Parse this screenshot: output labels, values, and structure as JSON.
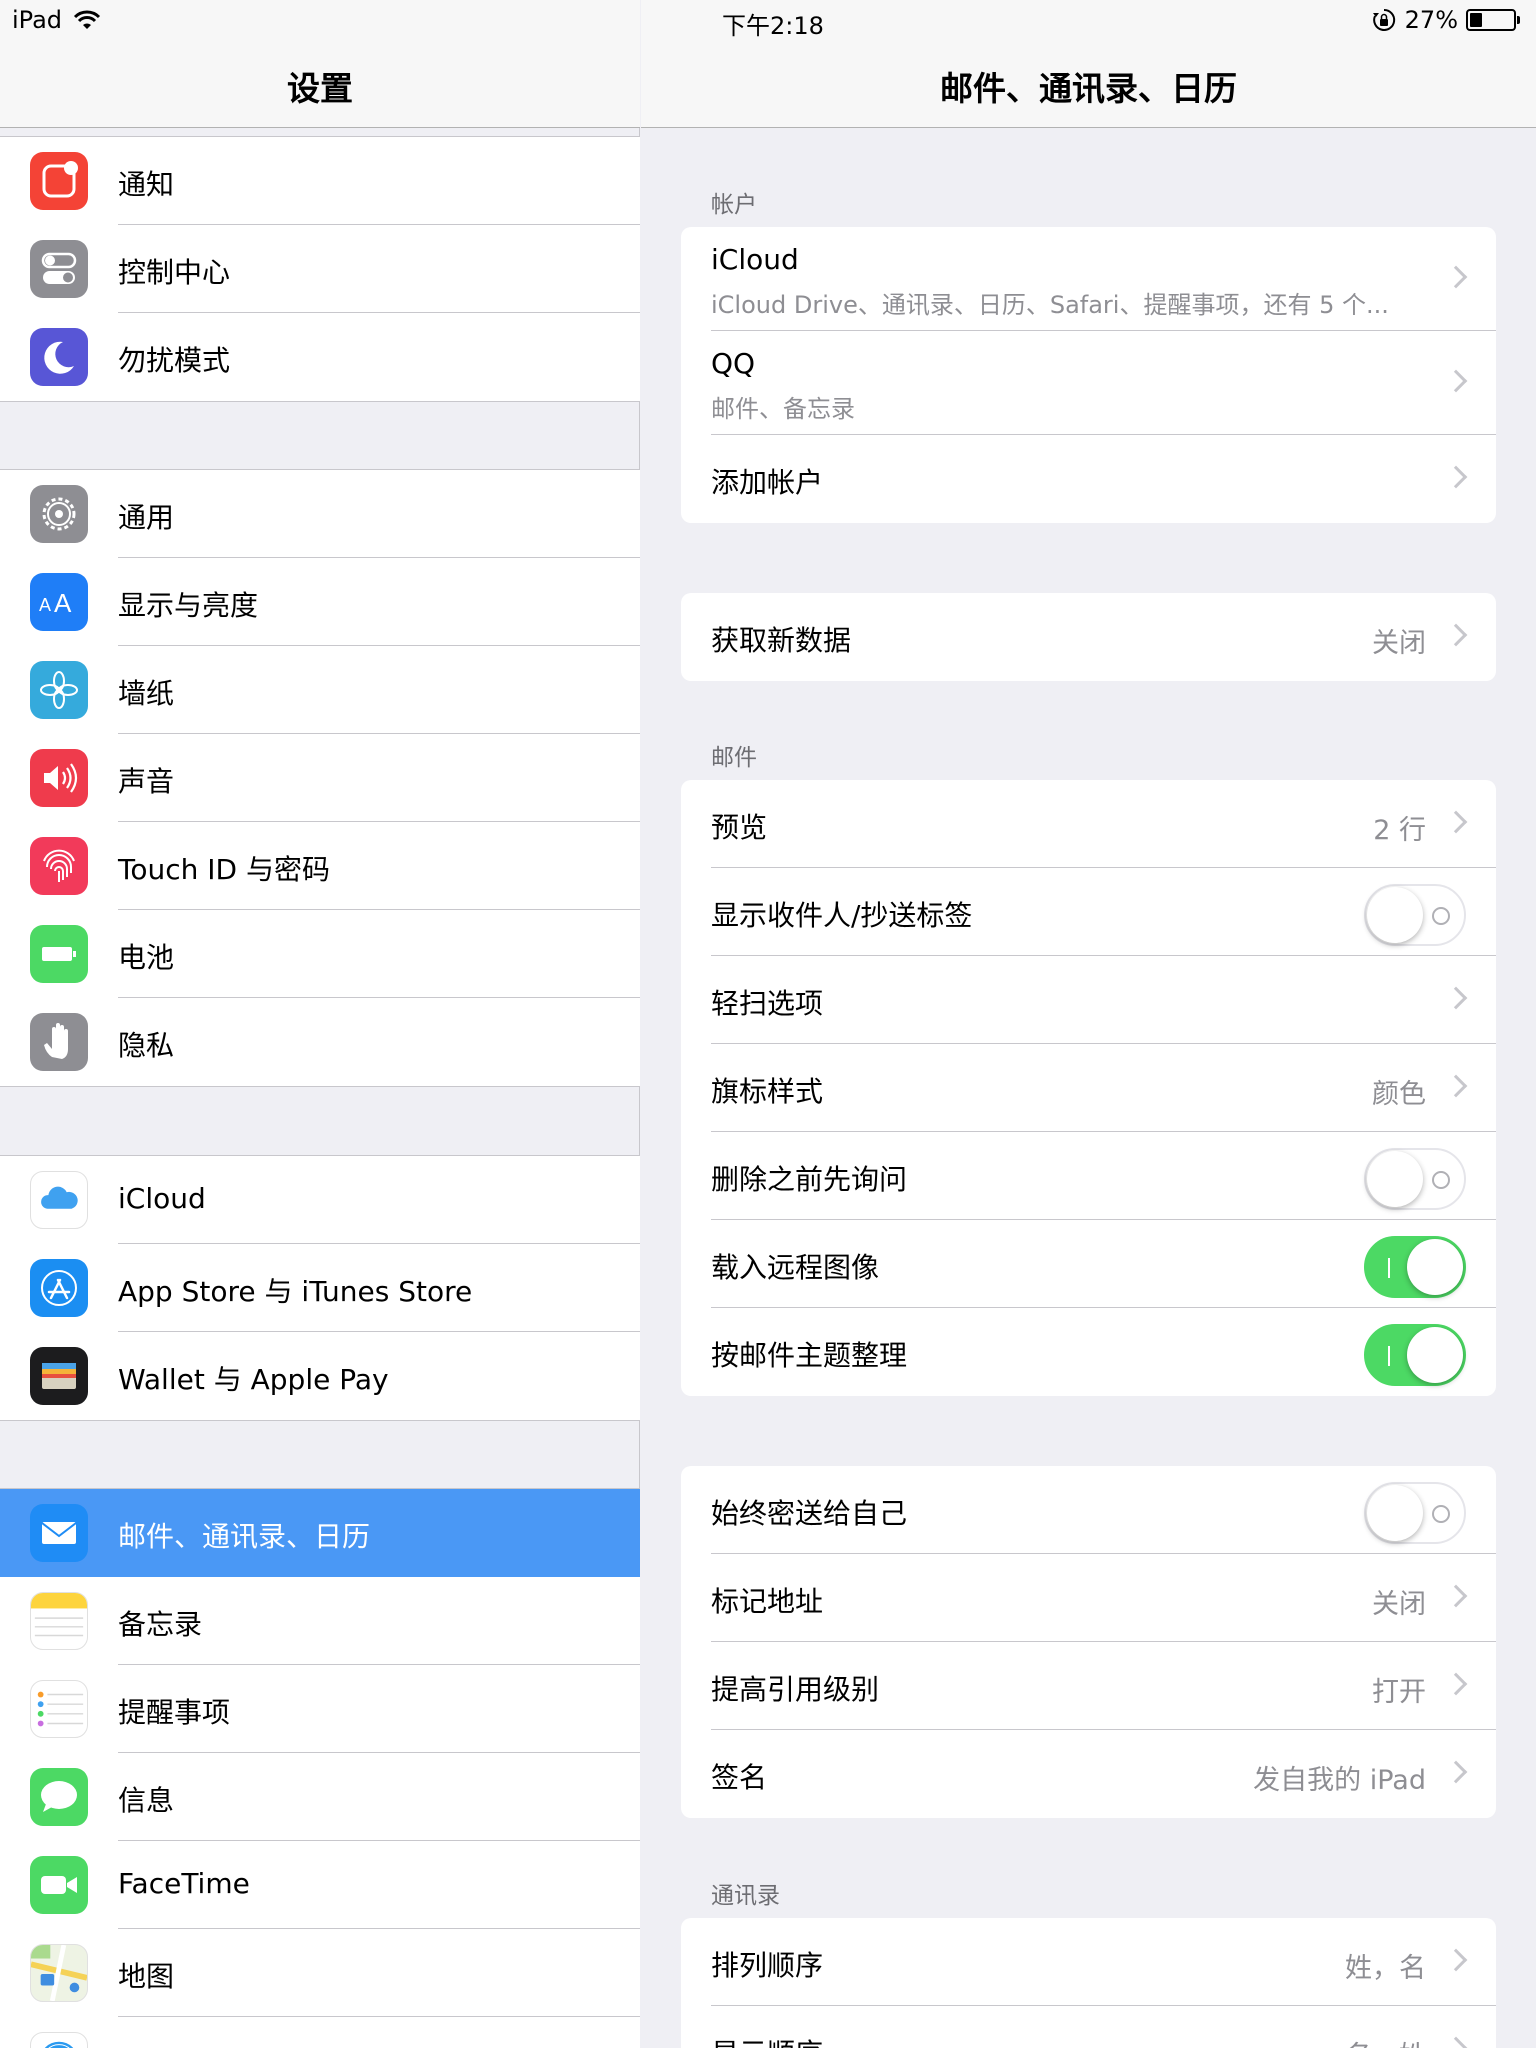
{
  "status_bar": {
    "device": "iPad",
    "time": "下午2:18",
    "battery": "27%"
  },
  "sidebar": {
    "title": "设置",
    "groups": [
      [
        {
          "label": "通知",
          "icon": "notifications-icon",
          "color": "#f44336"
        },
        {
          "label": "控制中心",
          "icon": "control-center-icon",
          "color": "#8e8e93"
        },
        {
          "label": "勿扰模式",
          "icon": "moon-icon",
          "color": "#5856d6"
        }
      ],
      [
        {
          "label": "通用",
          "icon": "gear-icon",
          "color": "#8e8e93"
        },
        {
          "label": "显示与亮度",
          "icon": "display-brightness-icon",
          "color": "#1f7ef7"
        },
        {
          "label": "墙纸",
          "icon": "wallpaper-icon",
          "color": "#35aadc"
        },
        {
          "label": "声音",
          "icon": "speaker-icon",
          "color": "#ef3b4c"
        },
        {
          "label": "Touch ID 与密码",
          "icon": "fingerprint-icon",
          "color": "#f23a5a"
        },
        {
          "label": "电池",
          "icon": "battery-icon",
          "color": "#4cd964"
        },
        {
          "label": "隐私",
          "icon": "hand-icon",
          "color": "#8e8e93"
        }
      ],
      [
        {
          "label": "iCloud",
          "icon": "icloud-icon",
          "color": "#ffffff"
        },
        {
          "label": "App Store 与 iTunes Store",
          "icon": "app-store-icon",
          "color": "#1b8ef2"
        },
        {
          "label": "Wallet 与 Apple Pay",
          "icon": "wallet-icon",
          "color": "#1c1c1e"
        }
      ],
      [
        {
          "label": "邮件、通讯录、日历",
          "icon": "mail-icon",
          "color": "#1f8cf5",
          "selected": true
        },
        {
          "label": "备忘录",
          "icon": "notes-icon",
          "color": "#ffffff"
        },
        {
          "label": "提醒事项",
          "icon": "reminders-icon",
          "color": "#ffffff"
        },
        {
          "label": "信息",
          "icon": "messages-icon",
          "color": "#4cd964"
        },
        {
          "label": "FaceTime",
          "icon": "facetime-icon",
          "color": "#4cd964"
        },
        {
          "label": "地图",
          "icon": "maps-icon",
          "color": "#ffffff"
        },
        {
          "label": "",
          "icon": "safari-icon",
          "color": "#ffffff"
        }
      ]
    ]
  },
  "detail": {
    "title": "邮件、通讯录、日历",
    "sections": {
      "accounts_header": "帐户",
      "accounts": [
        {
          "label": "iCloud",
          "sub": "iCloud Drive、通讯录、日历、Safari、提醒事项，还有 5 个..."
        },
        {
          "label": "QQ",
          "sub": "邮件、备忘录"
        },
        {
          "label": "添加帐户"
        }
      ],
      "fetch": {
        "label": "获取新数据",
        "value": "关闭"
      },
      "mail_header": "邮件",
      "mail": [
        {
          "label": "预览",
          "value": "2 行",
          "type": "nav"
        },
        {
          "label": "显示收件人/抄送标签",
          "type": "toggle",
          "on": false
        },
        {
          "label": "轻扫选项",
          "type": "nav"
        },
        {
          "label": "旗标样式",
          "value": "颜色",
          "type": "nav"
        },
        {
          "label": "删除之前先询问",
          "type": "toggle",
          "on": false
        },
        {
          "label": "载入远程图像",
          "type": "toggle",
          "on": true
        },
        {
          "label": "按邮件主题整理",
          "type": "toggle",
          "on": true
        }
      ],
      "mail2": [
        {
          "label": "始终密送给自己",
          "type": "toggle",
          "on": false
        },
        {
          "label": "标记地址",
          "value": "关闭",
          "type": "nav"
        },
        {
          "label": "提高引用级别",
          "value": "打开",
          "type": "nav"
        },
        {
          "label": "签名",
          "value": "发自我的 iPad",
          "type": "nav"
        }
      ],
      "contacts_header": "通讯录",
      "contacts": [
        {
          "label": "排列顺序",
          "value": "姓，名",
          "type": "nav"
        },
        {
          "label": "显示顺序",
          "value": "名，姓",
          "type": "nav"
        }
      ]
    }
  }
}
